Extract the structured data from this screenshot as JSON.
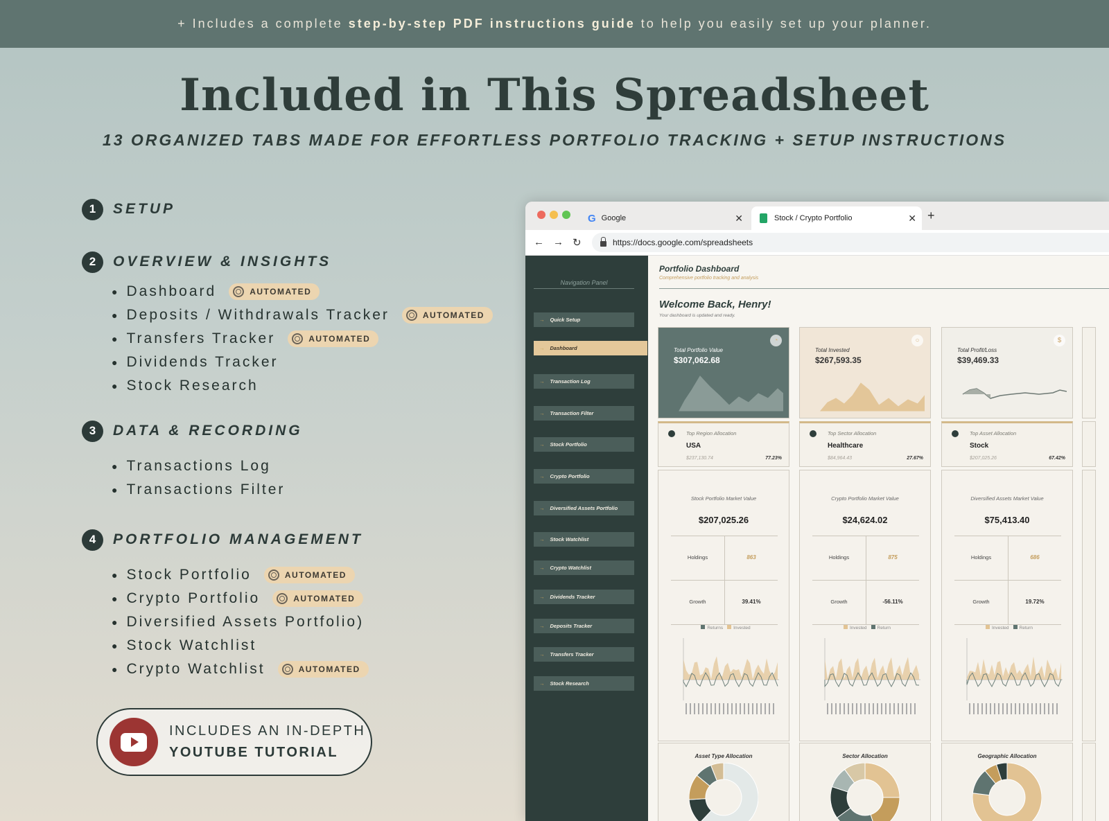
{
  "banner": {
    "prefix": "+ Includes a complete ",
    "bold": "step-by-step PDF instructions guide",
    "suffix": " to help you easily set up your planner."
  },
  "headline": "Included in This Spreadsheet",
  "subheadline": "13 ORGANIZED TABS MADE FOR EFFORTLESS PORTFOLIO TRACKING + SETUP INSTRUCTIONS",
  "badge_label": "AUTOMATED",
  "sections": [
    {
      "num": "1",
      "title": "SETUP",
      "items": []
    },
    {
      "num": "2",
      "title": "OVERVIEW & INSIGHTS",
      "items": [
        {
          "label": "Dashboard",
          "automated": true
        },
        {
          "label": "Deposits / Withdrawals Tracker",
          "automated": true
        },
        {
          "label": "Transfers Tracker",
          "automated": true
        },
        {
          "label": "Dividends Tracker",
          "automated": false
        },
        {
          "label": "Stock Research",
          "automated": false
        }
      ]
    },
    {
      "num": "3",
      "title": "DATA & RECORDING",
      "items": [
        {
          "label": "Transactions Log",
          "automated": false
        },
        {
          "label": "Transactions Filter",
          "automated": false
        }
      ]
    },
    {
      "num": "4",
      "title": "PORTFOLIO MANAGEMENT",
      "items": [
        {
          "label": "Stock Portfolio",
          "automated": true
        },
        {
          "label": "Crypto Portfolio",
          "automated": true
        },
        {
          "label": "Diversified Assets Portfolio)",
          "automated": false
        },
        {
          "label": "Stock Watchlist",
          "automated": false
        },
        {
          "label": "Crypto Watchlist",
          "automated": true
        }
      ]
    }
  ],
  "youtube": {
    "line1": "INCLUDES AN IN-DEPTH",
    "line2": "YOUTUBE TUTORIAL"
  },
  "browser": {
    "tab1": "Google",
    "tab2": "Stock / Crypto Portfolio",
    "url": "https://docs.google.com/spreadsheets",
    "new_tab": "+",
    "close": "✕"
  },
  "sidebar": {
    "title": "Navigation Panel",
    "items": [
      {
        "label": "Quick Setup",
        "active": false
      },
      {
        "label": "Dashboard",
        "active": true
      },
      {
        "label": "Transaction Log",
        "active": false
      },
      {
        "label": "Transaction Filter",
        "active": false
      },
      {
        "label": "Stock Portfolio",
        "active": false
      },
      {
        "label": "Crypto Portfolio",
        "active": false
      },
      {
        "label": "Diversified Assets Portfolio",
        "active": false
      },
      {
        "label": "Stock Watchlist",
        "active": false
      },
      {
        "label": "Crypto Watchlist",
        "active": false
      },
      {
        "label": "Dividends Tracker",
        "active": false
      },
      {
        "label": "Deposits Tracker",
        "active": false
      },
      {
        "label": "Transfers Tracker",
        "active": false
      },
      {
        "label": "Stock Research",
        "active": false
      }
    ]
  },
  "dashboard": {
    "title": "Portfolio Dashboard",
    "subtitle": "Comprehensive portfolio tracking and analysis",
    "welcome": "Welcome Back, Henry!",
    "welcome_sub": "Your dashboard is updated and ready.",
    "kpis": [
      {
        "label": "Total Portfolio Value",
        "value": "$307,062.68",
        "color": "#5f7470",
        "text": "#ffffff",
        "fill": "#8fa09c",
        "icon": "◔"
      },
      {
        "label": "Total Invested",
        "value": "$267,593.35",
        "color": "#f1e6d7",
        "text": "#333333",
        "fill": "#e2c393",
        "icon": "○"
      },
      {
        "label": "Total Profit/Loss",
        "value": "$39,469.33",
        "color": "#f1efe9",
        "text": "#333333",
        "fill": "#a8aea6",
        "icon": "$"
      }
    ],
    "allocations": [
      {
        "label": "Top Region Allocation",
        "value": "USA",
        "amount": "$237,130.74",
        "pct": "77.23%"
      },
      {
        "label": "Top Sector Allocation",
        "value": "Healthcare",
        "amount": "$84,964.43",
        "pct": "27.67%"
      },
      {
        "label": "Top Asset Allocation",
        "value": "Stock",
        "amount": "$207,025.26",
        "pct": "67.42%"
      }
    ],
    "market": [
      {
        "label": "Stock Portfolio Market Value",
        "value": "$207,025.26",
        "holdings_label": "Holdings",
        "holdings": "863",
        "growth_label": "Growth",
        "growth": "39.41%",
        "legend": [
          "Returns",
          "Invested"
        ]
      },
      {
        "label": "Crypto Portfolio Market Value",
        "value": "$24,624.02",
        "holdings_label": "Holdings",
        "holdings": "875",
        "growth_label": "Growth",
        "growth": "-56.11%",
        "legend": [
          "Invested",
          "Return"
        ]
      },
      {
        "label": "Diversified Assets Market Value",
        "value": "$75,413.40",
        "holdings_label": "Holdings",
        "holdings": "686",
        "growth_label": "Growth",
        "growth": "19.72%",
        "legend": [
          "Invested",
          "Return"
        ]
      }
    ],
    "pies": [
      {
        "label": "Asset Type Allocation"
      },
      {
        "label": "Sector Allocation"
      },
      {
        "label": "Geographic Allocation"
      }
    ]
  },
  "colors": {
    "accent": "#e4c89a",
    "dark": "#2e3e3b",
    "youtube": "#9c3533"
  }
}
